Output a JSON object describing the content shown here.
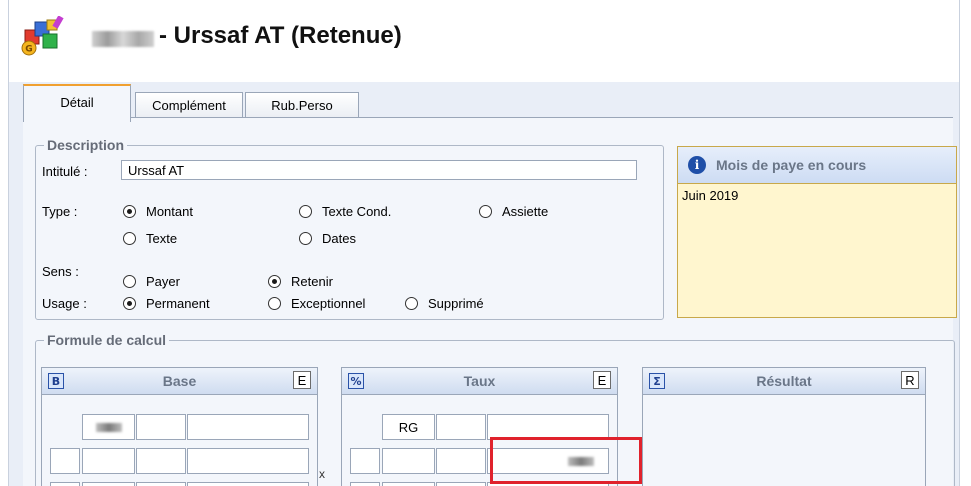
{
  "window": {
    "title": "- Urssaf AT (Retenue)",
    "icon": "app-pay-icon"
  },
  "tabs": [
    {
      "label": "Détail",
      "active": true
    },
    {
      "label": "Complément",
      "active": false
    },
    {
      "label": "Rub.Perso",
      "active": false
    }
  ],
  "description": {
    "legend": "Description",
    "intitule_label": "Intitulé :",
    "intitule_value": "Urssaf AT",
    "type_label": "Type :",
    "type_options": [
      "Montant",
      "Texte Cond.",
      "Assiette",
      "Texte",
      "Dates"
    ],
    "type_selected": "Montant",
    "sens_label": "Sens :",
    "sens_options": [
      "Payer",
      "Retenir"
    ],
    "sens_selected": "Retenir",
    "usage_label": "Usage :",
    "usage_options": [
      "Permanent",
      "Exceptionnel",
      "Supprimé"
    ],
    "usage_selected": "Permanent"
  },
  "info": {
    "title": "Mois de paye en cours",
    "icon": "info-icon",
    "value": "Juin 2019"
  },
  "formule": {
    "legend": "Formule de calcul",
    "base": {
      "title": "Base",
      "icon_text": "B",
      "button": "E",
      "cell_text": ""
    },
    "taux": {
      "title": "Taux",
      "icon_text": "%",
      "button": "E",
      "cell_text": "RG"
    },
    "resultat": {
      "title": "Résultat",
      "icon_text": "Σ",
      "button": "R"
    },
    "operator": "x"
  },
  "colors": {
    "accent_tab": "#f0a030",
    "highlight": "#e0222c",
    "info_background": "#fff6cf"
  }
}
